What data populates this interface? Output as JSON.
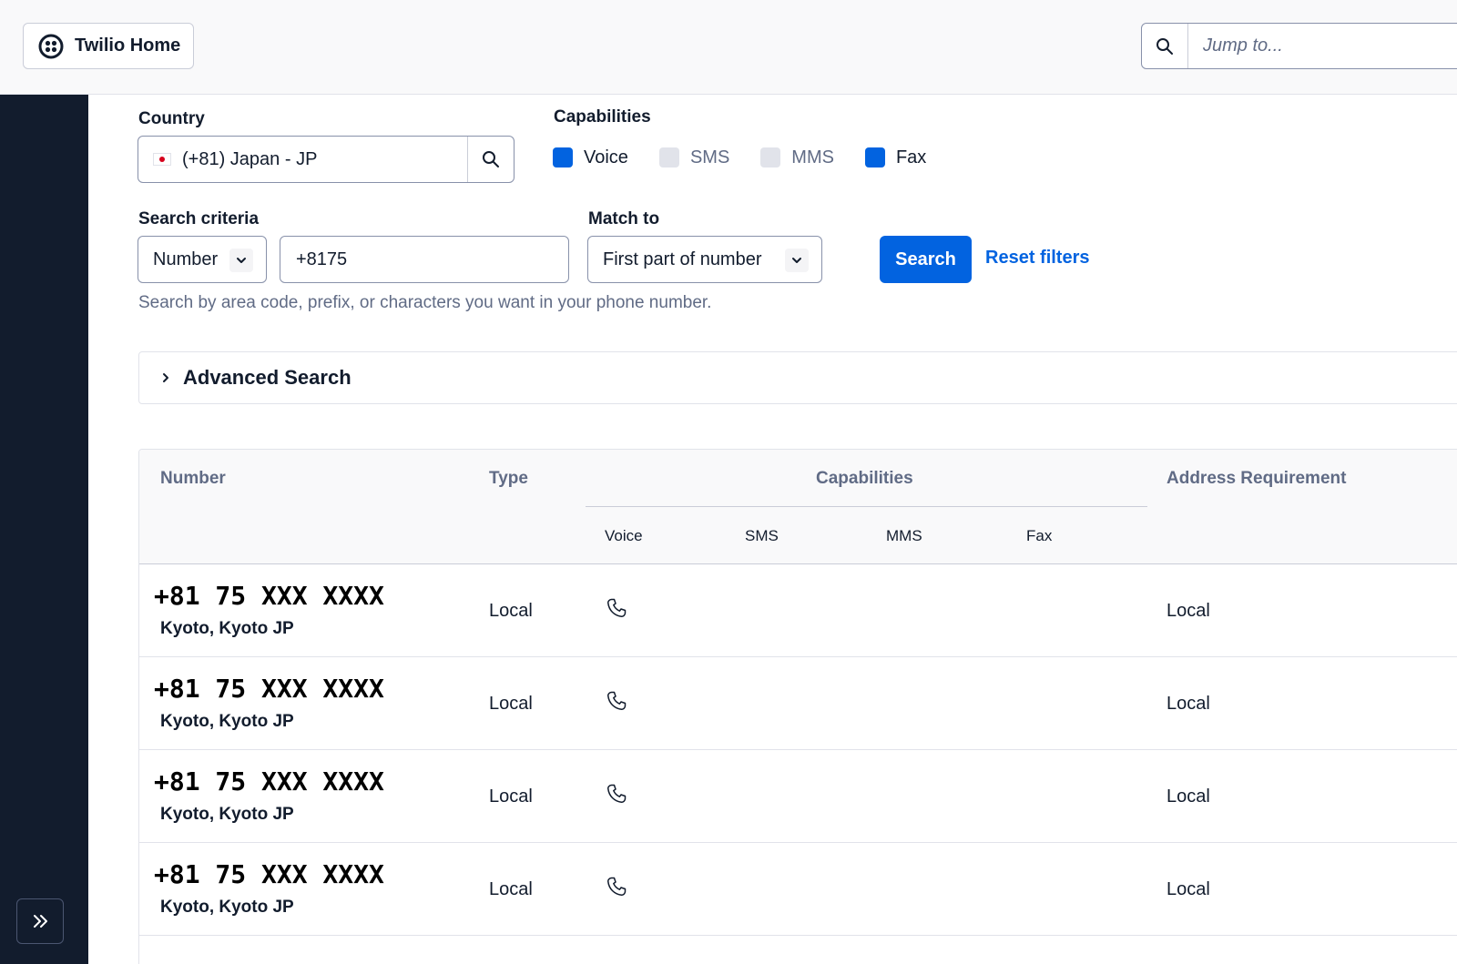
{
  "topbar": {
    "home_label": "Twilio Home",
    "jump_placeholder": "Jump to..."
  },
  "filters": {
    "country_label": "Country",
    "country_value": "(+81) Japan - JP",
    "capabilities_label": "Capabilities",
    "capabilities": [
      {
        "label": "Voice",
        "checked": true
      },
      {
        "label": "SMS",
        "checked": false
      },
      {
        "label": "MMS",
        "checked": false
      },
      {
        "label": "Fax",
        "checked": true
      }
    ],
    "criteria_label": "Search criteria",
    "criteria_value": "Number",
    "number_value": "+8175",
    "match_label": "Match to",
    "match_value": "First part of number",
    "search_button": "Search",
    "reset_link": "Reset filters",
    "help_text": "Search by area code, prefix, or characters you want in your phone number."
  },
  "advanced": {
    "label": "Advanced Search"
  },
  "table": {
    "headers": {
      "number": "Number",
      "type": "Type",
      "capabilities": "Capabilities",
      "address": "Address Requirement"
    },
    "subheaders": [
      "Voice",
      "SMS",
      "MMS",
      "Fax"
    ],
    "rows": [
      {
        "number": "+81 75 XXX XXXX",
        "location": "Kyoto, Kyoto JP",
        "type": "Local",
        "address": "Local"
      },
      {
        "number": "+81 75 XXX XXXX",
        "location": "Kyoto, Kyoto JP",
        "type": "Local",
        "address": "Local"
      },
      {
        "number": "+81 75 XXX XXXX",
        "location": "Kyoto, Kyoto JP",
        "type": "Local",
        "address": "Local"
      },
      {
        "number": "+81 75 XXX XXXX",
        "location": "Kyoto, Kyoto JP",
        "type": "Local",
        "address": "Local"
      }
    ]
  },
  "colors": {
    "accent": "#0263e0",
    "sidebar": "#121c2d"
  }
}
